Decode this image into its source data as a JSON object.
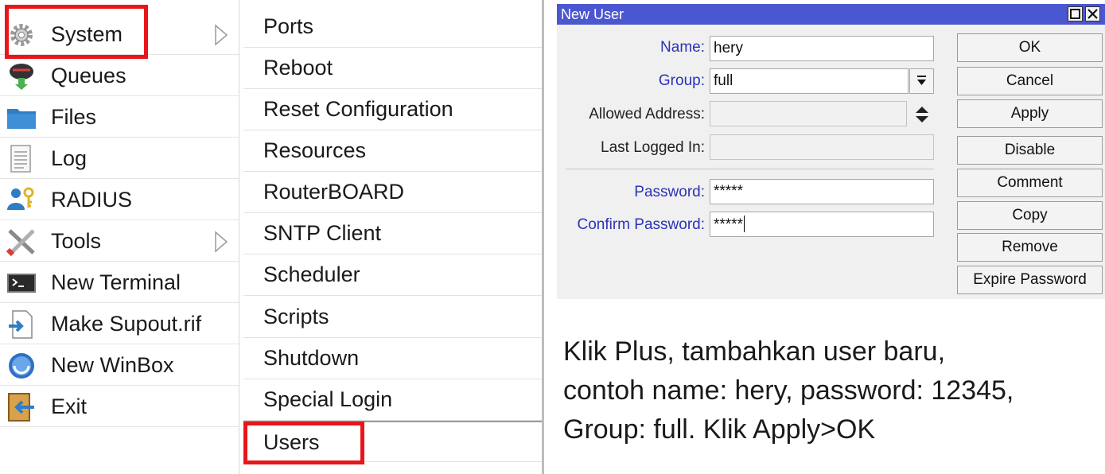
{
  "left_menu": {
    "items": [
      {
        "label": "System",
        "icon": "gear-icon"
      },
      {
        "label": "Queues",
        "icon": "queues-icon"
      },
      {
        "label": "Files",
        "icon": "folder-icon"
      },
      {
        "label": "Log",
        "icon": "log-icon"
      },
      {
        "label": "RADIUS",
        "icon": "radius-users-icon"
      },
      {
        "label": "Tools",
        "icon": "tools-icon"
      },
      {
        "label": "New Terminal",
        "icon": "terminal-icon"
      },
      {
        "label": "Make Supout.rif",
        "icon": "supout-file-icon"
      },
      {
        "label": "New WinBox",
        "icon": "winbox-icon"
      },
      {
        "label": "Exit",
        "icon": "exit-door-icon"
      }
    ]
  },
  "sub_menu": {
    "items": [
      "Ports",
      "Reboot",
      "Reset Configuration",
      "Resources",
      "RouterBOARD",
      "SNTP Client",
      "Scheduler",
      "Scripts",
      "Shutdown",
      "Special Login",
      "Users"
    ]
  },
  "dialog": {
    "title": "New User",
    "fields": {
      "name": {
        "label": "Name:",
        "value": "hery"
      },
      "group": {
        "label": "Group:",
        "value": "full"
      },
      "allowed_address": {
        "label": "Allowed Address:",
        "value": ""
      },
      "last_logged_in": {
        "label": "Last Logged In:",
        "value": ""
      },
      "password": {
        "label": "Password:",
        "value": "*****"
      },
      "confirm_password": {
        "label": "Confirm Password:",
        "value": "*****"
      }
    },
    "buttons": [
      "OK",
      "Cancel",
      "Apply",
      "Disable",
      "Comment",
      "Copy",
      "Remove",
      "Expire Password"
    ]
  },
  "instruction": {
    "lines": [
      "Klik Plus, tambahkan user baru,",
      "contoh name: hery, password: 12345,",
      "Group: full. Klik Apply>OK"
    ]
  },
  "colors": {
    "title_bar": "#4b56d1",
    "highlight_box": "#e8161a",
    "field_label_blue": "#2b33b5"
  }
}
